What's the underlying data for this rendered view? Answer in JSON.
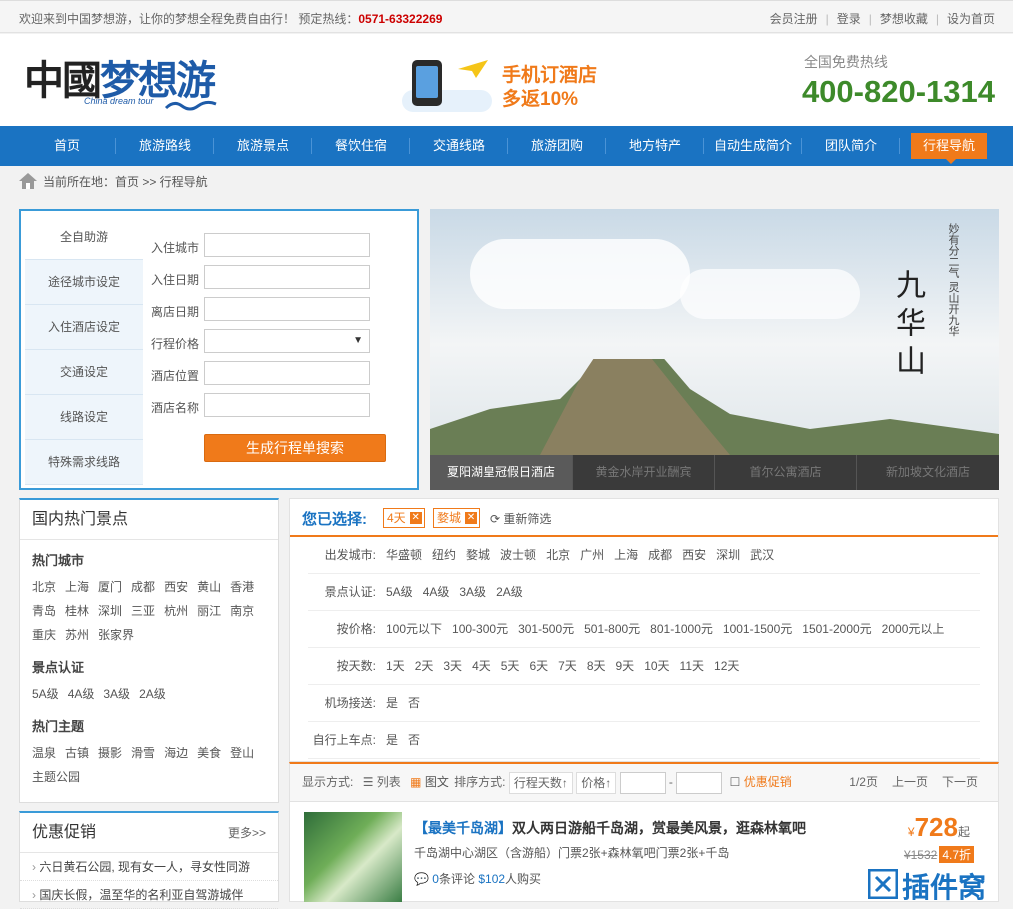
{
  "topbar": {
    "welcome": "欢迎来到中国梦想游，让你的梦想全程免费自由行！ 预定热线：",
    "hotline": "0571-63322269",
    "links": [
      "会员注册",
      "登录",
      "梦想收藏",
      "设为首页"
    ]
  },
  "logo": {
    "cn_1": "中國",
    "cn_2": "梦想游",
    "en": "China dream tour"
  },
  "promo": {
    "line1": "手机订酒店",
    "line2": "多返10%"
  },
  "hotline": {
    "label": "全国免费热线",
    "number": "400-820-1314"
  },
  "nav": [
    "首页",
    "旅游路线",
    "旅游景点",
    "餐饮住宿",
    "交通线路",
    "旅游团购",
    "地方特产",
    "自动生成简介",
    "团队简介",
    "行程导航"
  ],
  "nav_active": "行程导航",
  "breadcrumb": "当前所在地：首页 >> 行程导航",
  "planner": {
    "tabs": [
      "全自助游",
      "途径城市设定",
      "入住酒店设定",
      "交通设定",
      "线路设定",
      "特殊需求线路"
    ],
    "fields": [
      "入住城市",
      "入住日期",
      "离店日期",
      "行程价格",
      "酒店位置",
      "酒店名称"
    ],
    "submit": "生成行程单搜索"
  },
  "banner": {
    "calligraphy": "九华山",
    "poem": "妙有分二气 灵山开九华",
    "thumbs": [
      "夏阳湖皇冠假日酒店",
      "黄金水岸开业酬宾",
      "首尔公寓酒店",
      "新加坡文化酒店"
    ]
  },
  "hotspots": {
    "title": "国内热门景点",
    "city_title": "热门城市",
    "cities": [
      "北京",
      "上海",
      "厦门",
      "成都",
      "西安",
      "黄山",
      "香港",
      "青岛",
      "桂林",
      "深圳",
      "三亚",
      "杭州",
      "丽江",
      "南京",
      "重庆",
      "苏州",
      "张家界"
    ],
    "cert_title": "景点认证",
    "certs": [
      "5A级",
      "4A级",
      "3A级",
      "2A级"
    ],
    "theme_title": "热门主题",
    "themes": [
      "温泉",
      "古镇",
      "摄影",
      "滑雪",
      "海边",
      "美食",
      "登山",
      "主题公园"
    ]
  },
  "promos": {
    "title": "优惠促销",
    "more": "更多>>",
    "items": [
      "六日黄石公园, 现有女一人，寻女性同游",
      "国庆长假，温至华的名利亚自驾游城伴"
    ]
  },
  "filter": {
    "selected_label": "您已选择:",
    "chips": [
      "4天",
      "婺城"
    ],
    "reset": "重新筛选",
    "rows": [
      {
        "k": "出发城市:",
        "v": [
          "华盛顿",
          "纽约",
          "婺城",
          "波士顿",
          "北京",
          "广州",
          "上海",
          "成都",
          "西安",
          "深圳",
          "武汉"
        ]
      },
      {
        "k": "景点认证:",
        "v": [
          "5A级",
          "4A级",
          "3A级",
          "2A级"
        ]
      },
      {
        "k": "按价格:",
        "v": [
          "100元以下",
          "100-300元",
          "301-500元",
          "501-800元",
          "801-1000元",
          "1001-1500元",
          "1501-2000元",
          "2000元以上"
        ]
      },
      {
        "k": "按天数:",
        "v": [
          "1天",
          "2天",
          "3天",
          "4天",
          "5天",
          "6天",
          "7天",
          "8天",
          "9天",
          "10天",
          "11天",
          "12天"
        ]
      },
      {
        "k": "机场接送:",
        "v": [
          "是",
          "否"
        ]
      },
      {
        "k": "自行上车点:",
        "v": [
          "是",
          "否"
        ]
      }
    ]
  },
  "sortbar": {
    "display": "显示方式:",
    "list": "列表",
    "pic": "图文",
    "sort": "排序方式:",
    "sort_days": "行程天数",
    "sort_price": "价格",
    "dash": "-",
    "promo": "优惠促销",
    "page": "1/2页",
    "prev": "上一页",
    "next": "下一页"
  },
  "product": {
    "tag": "【最美千岛湖】",
    "title": "双人两日游船千岛湖，赏最美风景，逛森林氧吧",
    "desc": "千岛湖中心湖区（含游船）门票2张+森林氧吧门票2张+千岛",
    "comments_n": "0",
    "comments": "条评论",
    "buyers_n": "102",
    "buyers": "人购买",
    "currency": "¥",
    "price": "728",
    "qi": "起",
    "old": "¥1532",
    "discount": "4.7折"
  },
  "watermark": "插件窝",
  "colors": {
    "blue": "#1a73c2",
    "orange": "#f07a1a",
    "green": "#3d8a2a",
    "red": "#cc0000"
  }
}
